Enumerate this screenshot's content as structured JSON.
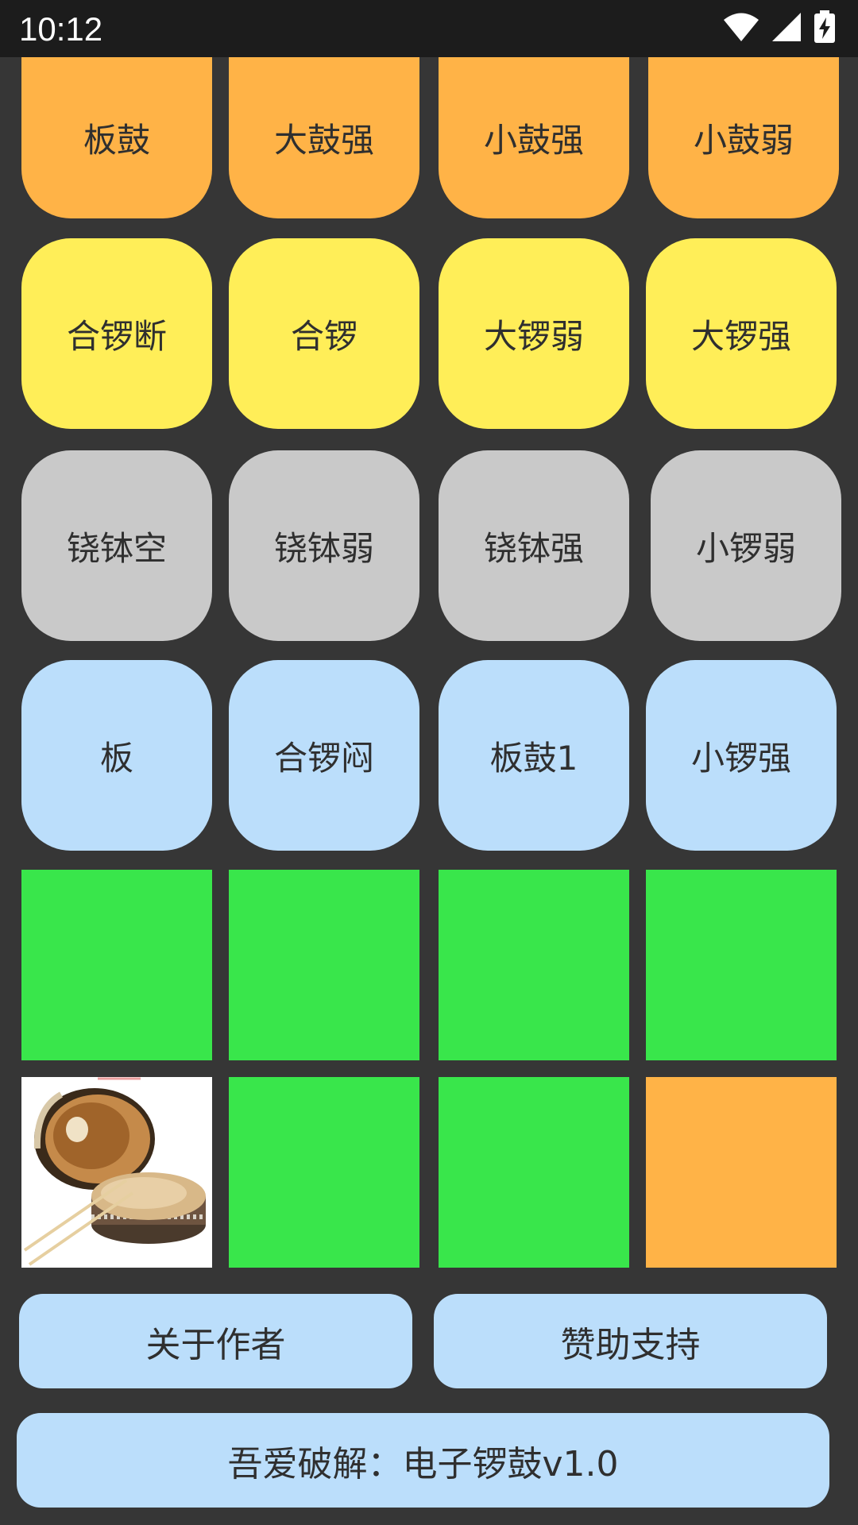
{
  "status_bar": {
    "time": "10:12",
    "icons": [
      "wifi-icon",
      "signal-icon",
      "battery-charging-icon"
    ]
  },
  "pads": {
    "row1": [
      "板鼓",
      "大鼓强",
      "小鼓强",
      "小鼓弱"
    ],
    "row2": [
      "合锣断",
      "合锣",
      "大锣弱",
      "大锣强"
    ],
    "row3": [
      "铙钵空",
      "铙钵弱",
      "铙钵强",
      "小锣弱"
    ],
    "row4": [
      "板",
      "合锣闷",
      "板鼓1",
      "小锣强"
    ]
  },
  "buttons": {
    "about": "关于作者",
    "sponsor": "赞助支持",
    "app_title": "吾爱破解：电子锣鼓v1.0"
  },
  "colors": {
    "orange": "#ffb347",
    "yellow": "#ffee58",
    "gray": "#c9c9c9",
    "blue": "#bbdefb",
    "green": "#39e64b",
    "background": "#363636"
  }
}
